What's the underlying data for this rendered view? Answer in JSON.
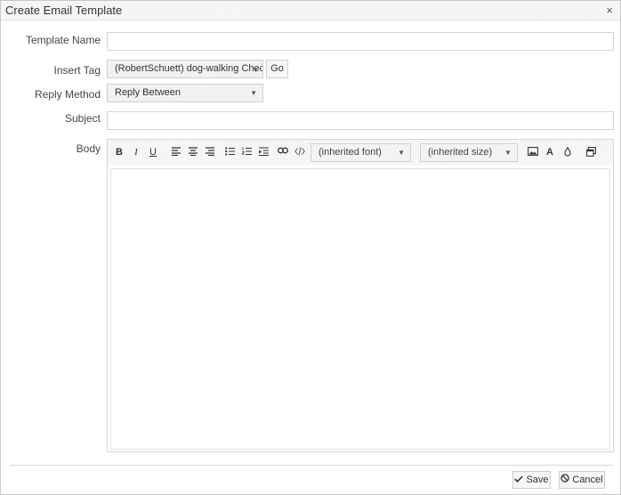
{
  "dialog": {
    "title": "Create Email Template",
    "close_label": "×"
  },
  "form": {
    "template_name": {
      "label": "Template Name",
      "value": ""
    },
    "insert_tag": {
      "label": "Insert Tag",
      "selected": "(RobertSchuett) dog-walking Checkbox",
      "go_label": "Go"
    },
    "reply_method": {
      "label": "Reply Method",
      "selected": "Reply Between"
    },
    "subject": {
      "label": "Subject",
      "value": ""
    },
    "body": {
      "label": "Body",
      "value": ""
    }
  },
  "toolbar": {
    "bold": "B",
    "italic": "I",
    "underline": "U",
    "font_select": "(inherited font)",
    "size_select": "(inherited size)",
    "font_color": "A",
    "icons": [
      "bold-icon",
      "italic-icon",
      "underline-icon",
      "align-left-icon",
      "align-center-icon",
      "align-right-icon",
      "bullet-list-icon",
      "numbered-list-icon",
      "indent-icon",
      "link-icon",
      "code-icon",
      "image-icon",
      "font-color-icon",
      "highlight-icon",
      "source-view-icon"
    ]
  },
  "footer": {
    "save_label": "Save",
    "cancel_label": "Cancel"
  },
  "colors": {
    "border": "#d6d6d6",
    "panel": "#f7f7f7"
  }
}
